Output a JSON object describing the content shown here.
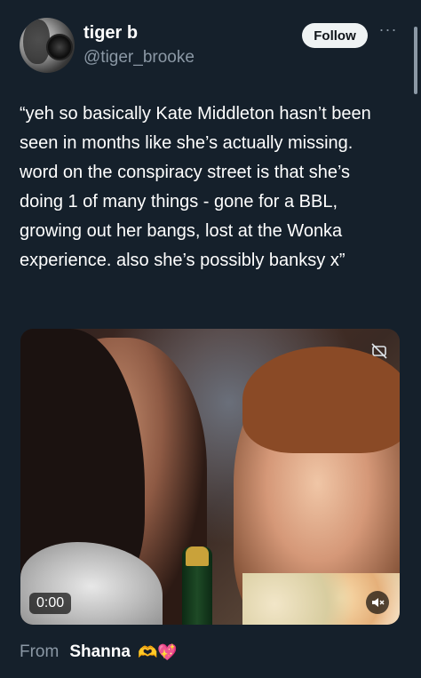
{
  "author": {
    "name": "tiger b",
    "handle": "@tiger_brooke"
  },
  "header": {
    "follow_label": "Follow",
    "more_label": "···"
  },
  "tweet": {
    "text": "“yeh so basically Kate Middleton hasn’t been seen in months like she’s actually missing. word on the conspiracy street is that she’s doing 1 of many things - gone for a BBL, growing out her bangs, lost at the Wonka experience. also she’s possibly banksy x”"
  },
  "media": {
    "timecode": "0:00",
    "icons": [
      "captions-off-icon",
      "volume-muted-icon"
    ]
  },
  "footer": {
    "from_label": "From",
    "from_name": "Shanna",
    "emojis": "🫶💖"
  },
  "colors": {
    "background": "#15202b",
    "secondary_text": "#8b98a5",
    "follow_bg": "#eff3f4"
  }
}
